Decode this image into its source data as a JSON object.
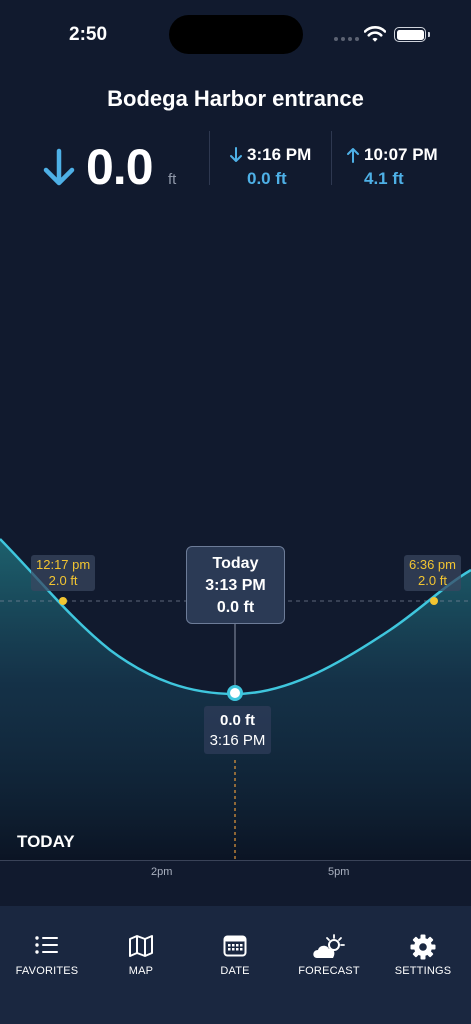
{
  "status_bar": {
    "time": "2:50"
  },
  "station": {
    "name": "Bodega Harbor entrance"
  },
  "current": {
    "value": "0.0",
    "unit": "ft",
    "direction": "falling"
  },
  "next_low": {
    "time": "3:16 PM",
    "height": "0.0 ft"
  },
  "next_high": {
    "time": "10:07 PM",
    "height": "4.1 ft"
  },
  "chart": {
    "markers": [
      {
        "time": "12:17 pm",
        "height": "2.0 ft"
      },
      {
        "time": "6:36 pm",
        "height": "2.0 ft"
      }
    ],
    "tooltip": {
      "day": "Today",
      "time": "3:13 PM",
      "height": "0.0 ft"
    },
    "low_label": {
      "height": "0.0 ft",
      "time": "3:16 PM"
    },
    "day_label": "TODAY",
    "axis_ticks": [
      "2pm",
      "5pm"
    ]
  },
  "tabs": [
    {
      "label": "FAVORITES",
      "icon": "list-icon"
    },
    {
      "label": "MAP",
      "icon": "map-icon"
    },
    {
      "label": "DATE",
      "icon": "calendar-icon"
    },
    {
      "label": "FORECAST",
      "icon": "weather-icon"
    },
    {
      "label": "SETTINGS",
      "icon": "gear-icon"
    }
  ],
  "colors": {
    "background": "#111a2e",
    "curve": "#3fc6dd",
    "accent_blue": "#4eb0e6",
    "marker_yellow": "#f2c531",
    "now_line": "#e59a3c",
    "tab_bar": "#1a2740"
  }
}
